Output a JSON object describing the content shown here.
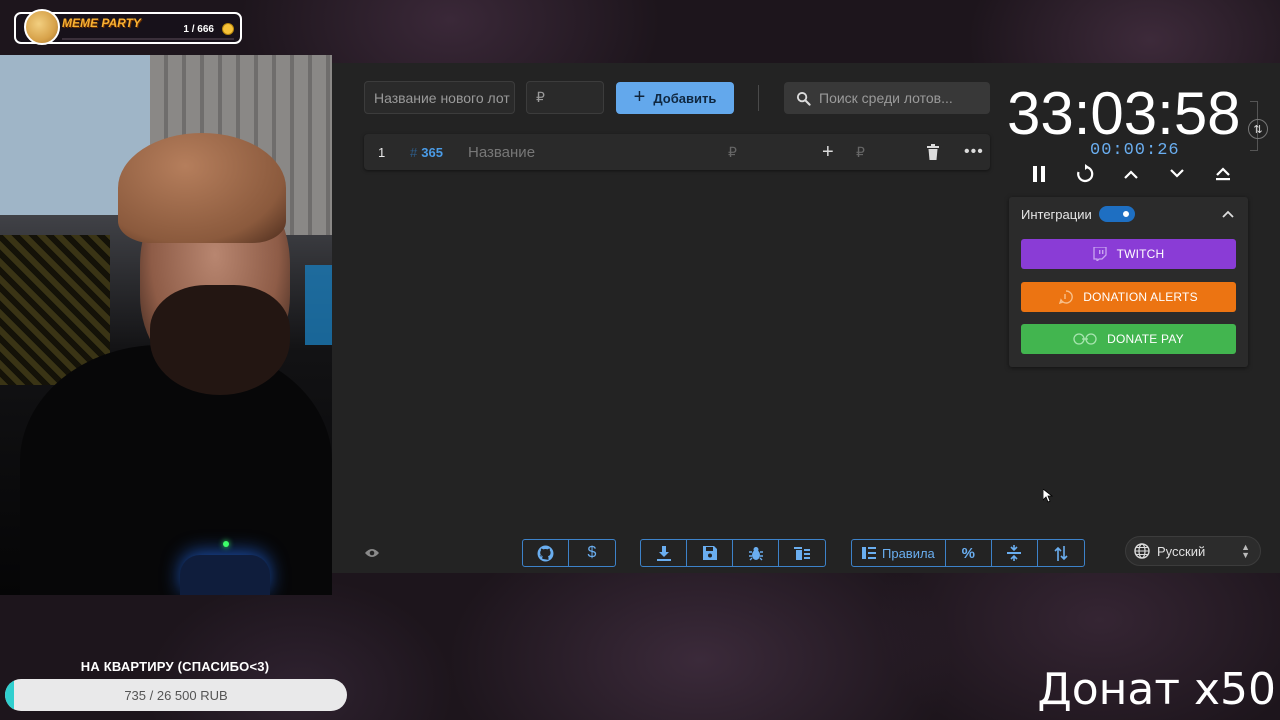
{
  "meme_widget": {
    "title": "MEME PARTY",
    "count": "1 / 666",
    "progress_fraction": 0.0015,
    "icons": [
      "doge-avatar-icon",
      "coin-icon"
    ]
  },
  "app": {
    "new_lot_placeholder": "Название нового лота",
    "new_lot_value": "Название нового лот",
    "amount_placeholder": "₽",
    "add_button_label": "Добавить",
    "search_placeholder": "Поиск среди лотов...",
    "lots": [
      {
        "number": "1",
        "id": "365",
        "name_placeholder": "Название",
        "currency": "₽",
        "add_currency": "₽"
      }
    ],
    "toolbar": {
      "rules_label": "Правила",
      "icons": [
        "github-icon",
        "dollar-icon",
        "download-icon",
        "save-icon",
        "bug-icon",
        "clear-list-icon",
        "rules-icon",
        "percent-icon",
        "split-icon",
        "sort-icon"
      ]
    },
    "language": "Русский"
  },
  "timer": {
    "main": "33:03:58",
    "elapsed": "00:00:26",
    "controls": [
      "pause-icon",
      "restart-icon",
      "chevron-up-icon",
      "chevron-down-icon",
      "eject-up-icon"
    ]
  },
  "integrations": {
    "title": "Интеграции",
    "enabled": true,
    "services": [
      {
        "label": "TWITCH",
        "color": "#8a3cd6"
      },
      {
        "label": "DONATION ALERTS",
        "color": "#ec7412"
      },
      {
        "label": "DONATE PAY",
        "color": "#42b54f"
      }
    ]
  },
  "goal": {
    "title": "НА КВАРТИРУ (СПАСИБО<3)",
    "progress_text": "735 / 26 500 RUB",
    "current": 735,
    "target": 26500
  },
  "overlay": {
    "donat_text": "Донат х50"
  },
  "colors": {
    "accent": "#63a8ec",
    "toolbar_blue": "#6aaef0",
    "goal_fill": "#31cfcf"
  }
}
